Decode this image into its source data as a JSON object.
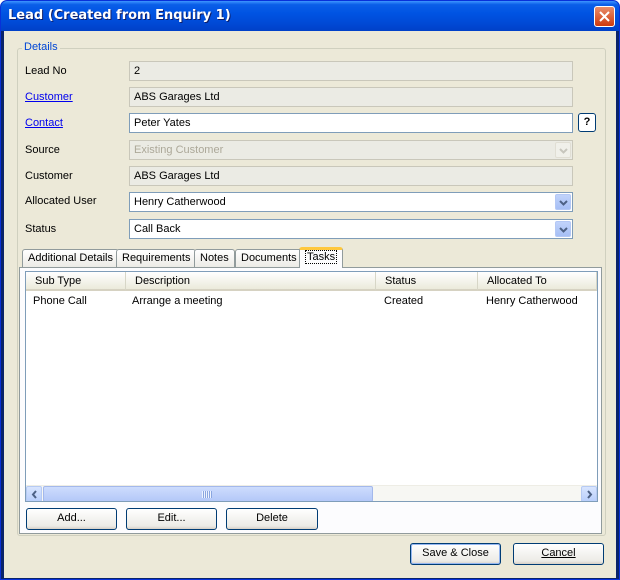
{
  "window": {
    "title": "Lead (Created from Enquiry 1)"
  },
  "details": {
    "legend": "Details",
    "lead_no": {
      "label": "Lead No",
      "value": "2"
    },
    "customer_link": {
      "label": "Customer",
      "value": "ABS Garages Ltd"
    },
    "contact": {
      "label": "Contact",
      "value": "Peter Yates",
      "help": "?"
    },
    "source": {
      "label": "Source",
      "value": "Existing Customer"
    },
    "customer": {
      "label": "Customer",
      "value": "ABS Garages Ltd"
    },
    "allocated_user": {
      "label": "Allocated User",
      "value": "Henry Catherwood"
    },
    "status": {
      "label": "Status",
      "value": "Call Back"
    }
  },
  "tabs": [
    {
      "label": "Additional Details"
    },
    {
      "label": "Requirements"
    },
    {
      "label": "Notes"
    },
    {
      "label": "Documents"
    },
    {
      "label": "Tasks"
    }
  ],
  "tasks": {
    "columns": [
      "Sub Type",
      "Description",
      "Status",
      "Allocated To"
    ],
    "rows": [
      {
        "sub_type": "Phone Call",
        "description": "Arrange a meeting",
        "status": "Created",
        "allocated_to": "Henry Catherwood"
      }
    ],
    "buttons": {
      "add": "Add...",
      "edit": "Edit...",
      "delete": "Delete"
    }
  },
  "footer": {
    "save_close": "Save & Close",
    "cancel": "Cancel"
  },
  "icons": {
    "close": "close-icon",
    "dropdown": "chevron-down-icon",
    "scroll_left": "arrow-left-icon",
    "scroll_right": "arrow-right-icon"
  },
  "colors": {
    "titlebar": "#0054e3",
    "link": "#0000ee",
    "legend": "#0046d5",
    "active_tab": "#ffc83c"
  }
}
